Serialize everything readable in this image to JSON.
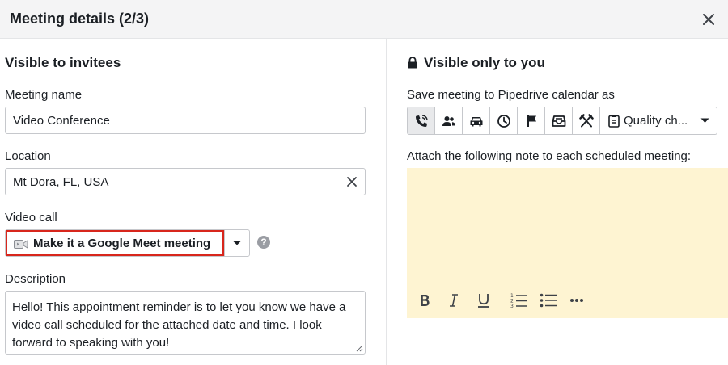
{
  "header": {
    "title": "Meeting details (2/3)"
  },
  "left": {
    "section_title": "Visible to invitees",
    "meeting_name": {
      "label": "Meeting name",
      "value": "Video Conference"
    },
    "location": {
      "label": "Location",
      "value": "Mt Dora, FL, USA"
    },
    "video_call": {
      "label": "Video call",
      "value": "Make it a Google Meet meeting",
      "help": "?"
    },
    "description": {
      "label": "Description",
      "value": "Hello! This appointment reminder is to let you know we have a video call scheduled for the attached date and time. I look forward to speaking with you!"
    }
  },
  "right": {
    "section_title": "Visible only to you",
    "calendar_label": "Save meeting to Pipedrive calendar as",
    "activity_types": [
      "call-icon",
      "meeting-icon",
      "car-icon",
      "clock-icon",
      "flag-icon",
      "inbox-icon",
      "lunch-icon"
    ],
    "selected_activity": "call-icon",
    "activity_dropdown": "Quality ch...",
    "note_label": "Attach the following note to each scheduled meeting:",
    "note_value": "",
    "formatting": [
      "bold-icon",
      "italic-icon",
      "underline-icon",
      "numbered-list-icon",
      "bulleted-list-icon",
      "more-icon"
    ]
  },
  "colors": {
    "highlight_border": "#d8261c",
    "note_background": "#fef4d2",
    "header_background": "#f4f4f5"
  }
}
